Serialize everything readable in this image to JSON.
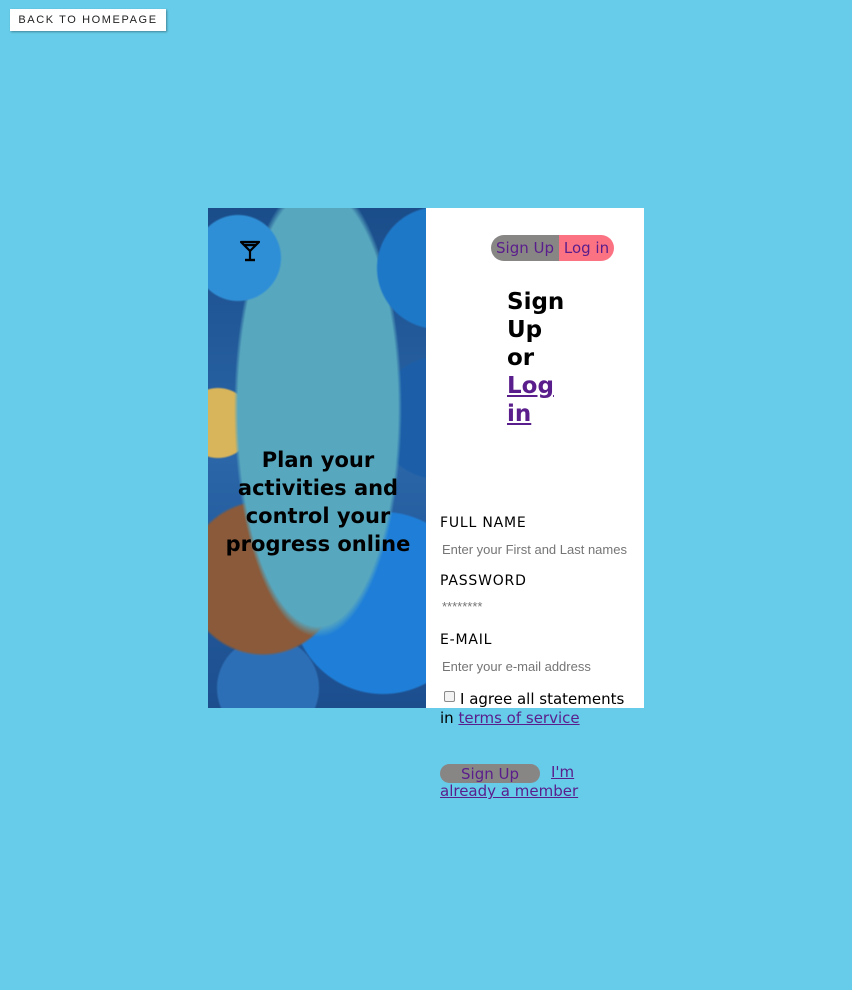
{
  "back_button": {
    "label": "BACK TO HOMEPAGE"
  },
  "left_panel": {
    "tagline": "Plan your activities and control your progress online"
  },
  "toggle": {
    "signup_label": "Sign Up",
    "login_label": "Log in"
  },
  "heading": {
    "prefix": "Sign Up or",
    "link": "Log in"
  },
  "form": {
    "full_name": {
      "label": "FULL NAME",
      "placeholder": "Enter your First and Last names"
    },
    "password": {
      "label": "PASSWORD",
      "placeholder": "********"
    },
    "email": {
      "label": "E-MAIL",
      "placeholder": "Enter your e-mail address"
    },
    "agree": {
      "text": "I agree all statements in ",
      "link": "terms of service"
    },
    "submit_label": "Sign Up",
    "member_link": "I'm already a member"
  },
  "colors": {
    "background": "#66cce9",
    "toggle_active": "#888585",
    "toggle_login": "#fb7283",
    "link": "#5a1e8c"
  }
}
